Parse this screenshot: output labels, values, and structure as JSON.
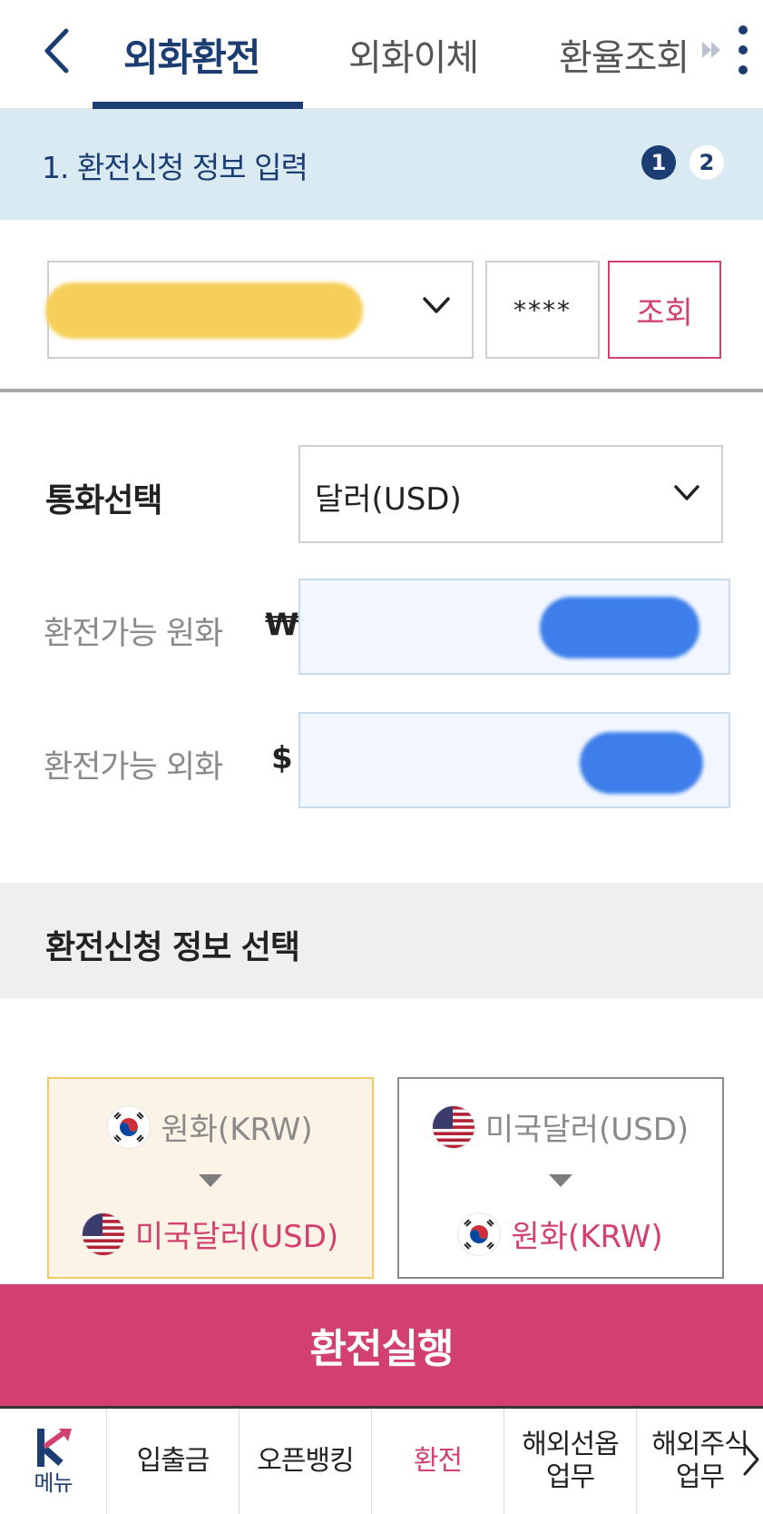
{
  "header": {
    "tabs": [
      {
        "label": "외화환전",
        "active": true
      },
      {
        "label": "외화이체",
        "active": false
      },
      {
        "label": "환율조회",
        "active": false
      }
    ]
  },
  "step": {
    "title": "1. 환전신청 정보 입력",
    "current": "1",
    "next": "2"
  },
  "account": {
    "password_mask": "****",
    "inquiry_label": "조회"
  },
  "currency": {
    "label": "통화선택",
    "selected": "달러(USD)"
  },
  "available": {
    "krw_label": "환전가능 원화",
    "krw_symbol": "₩",
    "fx_label": "환전가능 외화",
    "fx_symbol": "$"
  },
  "section": {
    "title": "환전신청 정보 선택"
  },
  "cards": [
    {
      "from": "원화(KRW)",
      "to": "미국달러(USD)",
      "selected": true
    },
    {
      "from": "미국달러(USD)",
      "to": "원화(KRW)",
      "selected": false
    }
  ],
  "execute_label": "환전실행",
  "bottom_nav": {
    "menu_label": "메뉴",
    "items": [
      {
        "label": "입출금",
        "active": false
      },
      {
        "label": "오픈뱅킹",
        "active": false
      },
      {
        "label": "환전",
        "active": true
      },
      {
        "label": "해외선옵\n업무",
        "line1": "해외선옵",
        "line2": "업무",
        "active": false
      },
      {
        "label": "해외주식\n업무",
        "line1": "해외주식",
        "line2": "업무",
        "active": false
      }
    ]
  },
  "colors": {
    "navy": "#1c3d72",
    "pink": "#d2416f",
    "step_bg": "#d9eaf3",
    "card_selected_bg": "#faf3e6"
  }
}
